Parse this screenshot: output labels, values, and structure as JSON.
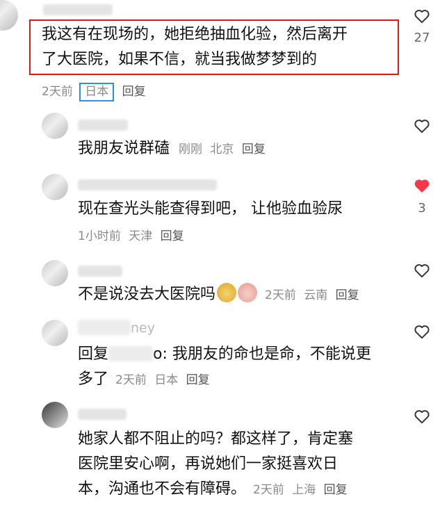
{
  "comments": [
    {
      "id": "c1",
      "name": "",
      "text_line1": "我这有在现场的，她拒绝抽血化验，然后离开",
      "text_line2": "了大医院，如果不信，就当我做梦梦到的",
      "time": "2天前",
      "location": "日本",
      "reply": "回复",
      "likes": "27",
      "liked": false
    },
    {
      "id": "c2",
      "text": "我朋友说群磕",
      "time": "刚刚",
      "location": "北京",
      "reply": "回复",
      "likes": "",
      "liked": false
    },
    {
      "id": "c3",
      "text": "现在查光头能查得到吧， 让他验血验尿",
      "time": "1小时前",
      "location": "天津",
      "reply": "回复",
      "likes": "3",
      "liked": true
    },
    {
      "id": "c4",
      "text": "不是说没去大医院吗",
      "emojis": [
        "dog-emoji",
        "pig-emoji"
      ],
      "time": "2天前",
      "location": "云南",
      "reply": "回复",
      "likes": "",
      "liked": false
    },
    {
      "id": "c5",
      "name": "ney",
      "text_prefix": "回复",
      "text_suffix": "o: 我朋友的命也是命，不能说更",
      "text_line2": "多了",
      "time": "2天前",
      "location": "日本",
      "reply": "回复",
      "likes": "",
      "liked": false
    },
    {
      "id": "c6",
      "text_line1": "她家人都不阻止的吗？都这样了，肯定塞",
      "text_line2": "医院里安心啊，再说她们一家挺喜欢日",
      "text_line3": "本，沟通也不会有障碍。",
      "time": "2天前",
      "location": "上海",
      "reply": "回复",
      "likes": "",
      "liked": false
    }
  ],
  "colors": {
    "highlight_red": "#e01818",
    "highlight_blue": "#2e8fe6",
    "liked_heart": "#f2384a",
    "meta_gray": "#8a8a8a"
  },
  "icons": [
    "heart-outline-icon",
    "heart-filled-icon"
  ]
}
